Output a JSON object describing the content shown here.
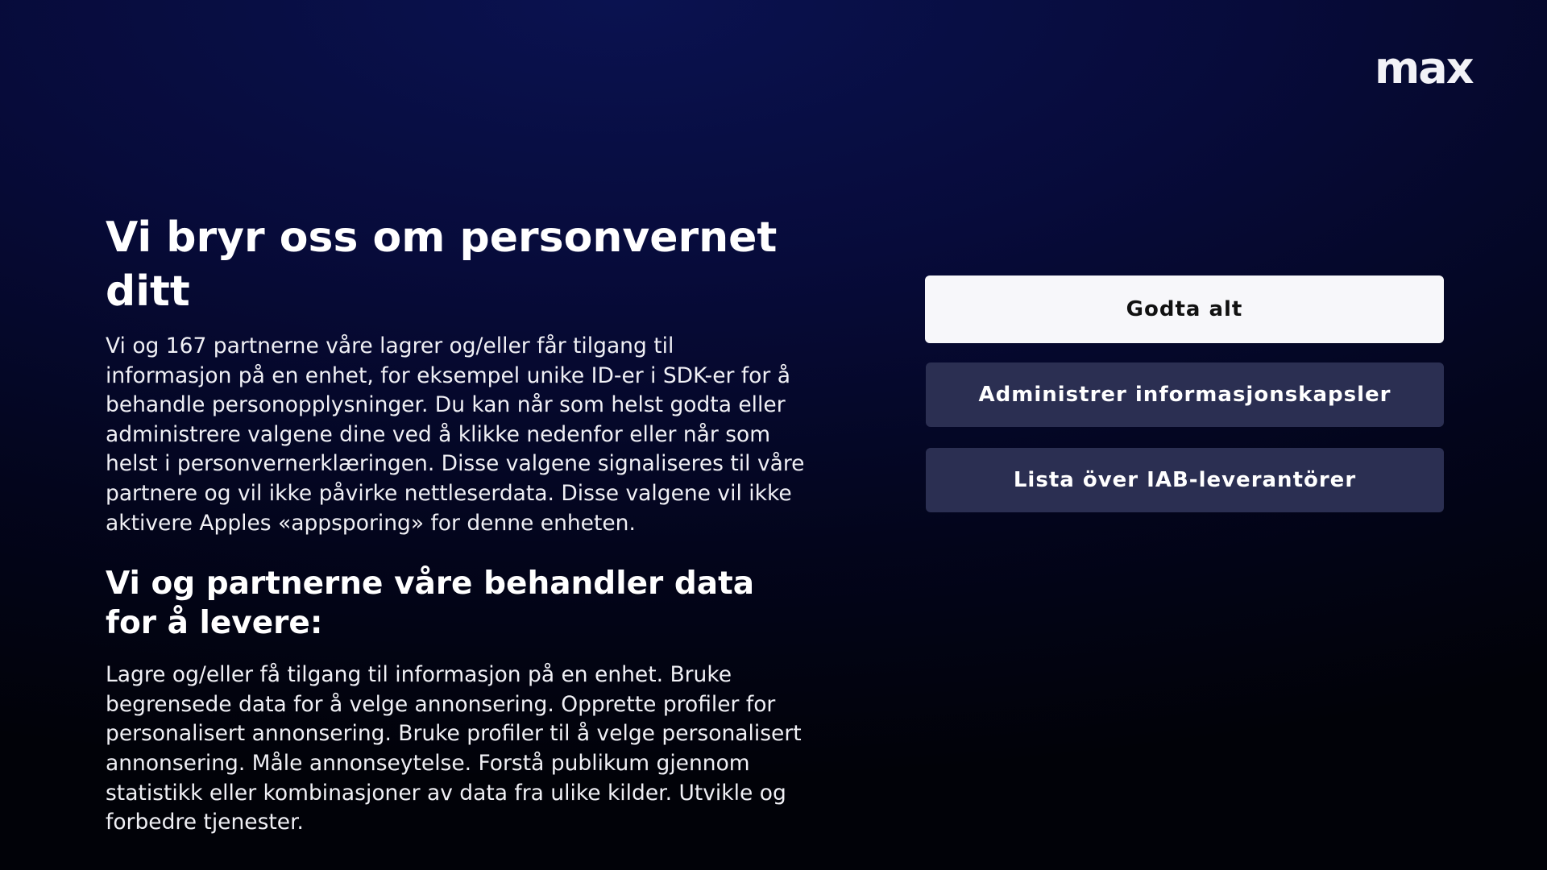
{
  "brand": {
    "logo_text": "max"
  },
  "consent": {
    "title": "Vi bryr oss om personvernet ditt",
    "description": "Vi og 167 partnerne våre lagrer og/eller får tilgang til informasjon på en enhet, for eksempel unike ID-er i SDK-er for å behandle personopplysninger. Du kan når som helst godta eller administrere valgene dine ved å klikke nedenfor eller når som helst i personvernerklæringen. Disse valgene signaliseres til våre partnere og vil ikke påvirke nettleserdata. Disse valgene vil ikke aktivere Apples «appsporing» for denne enheten.",
    "purposes_heading": "Vi og partnerne våre behandler data for å levere:",
    "purposes_text": "Lagre og/eller få tilgang til informasjon på en enhet. Bruke begrensede data for å velge annonsering. Opprette profiler for personalisert annonsering. Bruke profiler til å velge personalisert annonsering. Måle annonseytelse. Forstå publikum gjennom statistikk eller kombinasjoner av data fra ulike kilder. Utvikle og forbedre tjenester."
  },
  "actions": {
    "accept_all": "Godta alt",
    "manage_cookies": "Administrer informasjonskapsler",
    "iab_vendors": "Lista över IAB-leverantörer"
  },
  "colors": {
    "background": "#060a35",
    "primary_button": "#f7f7fa",
    "secondary_button": "#2b2f52",
    "text": "#ffffff"
  }
}
